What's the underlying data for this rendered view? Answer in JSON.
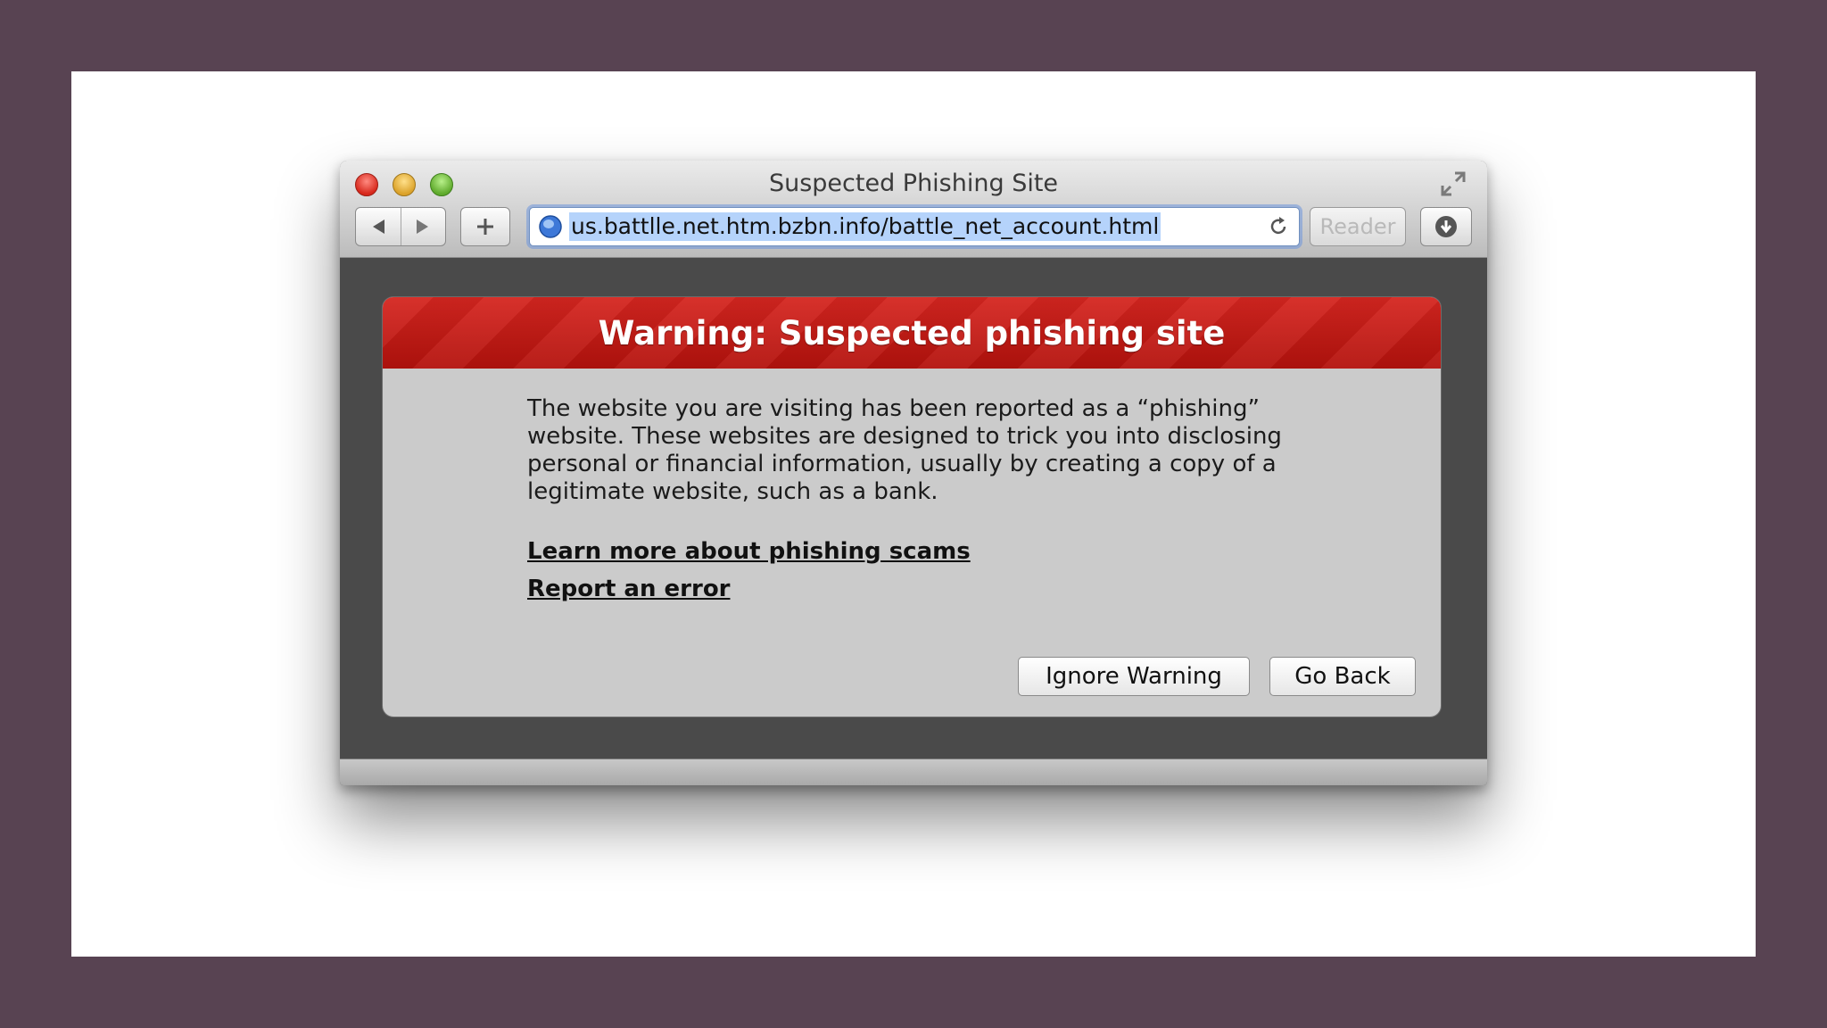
{
  "window": {
    "title": "Suspected Phishing Site"
  },
  "toolbar": {
    "url": "us.battlle.net.htm.bzbn.info/battle_net_account.html",
    "reader_label": "Reader"
  },
  "warning": {
    "title": "Warning: Suspected phishing site",
    "body": "The website you are visiting has been reported as a “phishing” website. These websites are designed to trick you into disclosing personal or financial information, usually by creating a copy of a legitimate website, such as a bank.",
    "link_learn_more": "Learn more about phishing scams",
    "link_report": "Report an error",
    "ignore_button": "Ignore Warning",
    "back_button": "Go Back"
  },
  "colors": {
    "background": "#584352",
    "warning_red": "#c81a14"
  }
}
